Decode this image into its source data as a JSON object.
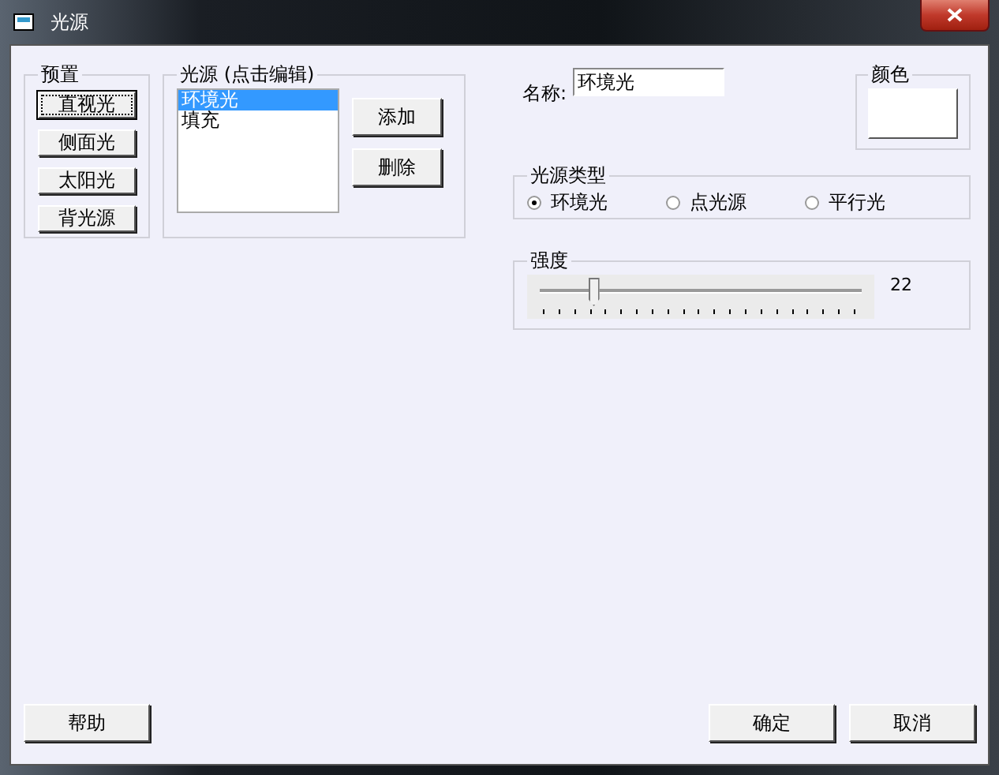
{
  "window": {
    "title": "光源"
  },
  "presets": {
    "title": "预置",
    "buttons": [
      {
        "label": "直视光",
        "focused": true
      },
      {
        "label": "侧面光",
        "focused": false
      },
      {
        "label": "太阳光",
        "focused": false
      },
      {
        "label": "背光源",
        "focused": false
      }
    ]
  },
  "sources": {
    "title": "光源 (点击编辑)",
    "items": [
      {
        "label": "环境光",
        "selected": true
      },
      {
        "label": "填充",
        "selected": false
      }
    ],
    "buttons": [
      "添加",
      "删除"
    ]
  },
  "name": {
    "label": "名称:",
    "value": "环境光"
  },
  "color": {
    "title": "颜色"
  },
  "light_type": {
    "title": "光源类型",
    "options": [
      {
        "label": "环境光",
        "selected": true
      },
      {
        "label": "点光源",
        "selected": false
      },
      {
        "label": "平行光",
        "selected": false
      }
    ]
  },
  "intensity": {
    "title": "强度",
    "level": 0.14,
    "reading": "22"
  },
  "footer": {
    "help": "帮助",
    "ok": "确定",
    "cancel": "取消"
  }
}
